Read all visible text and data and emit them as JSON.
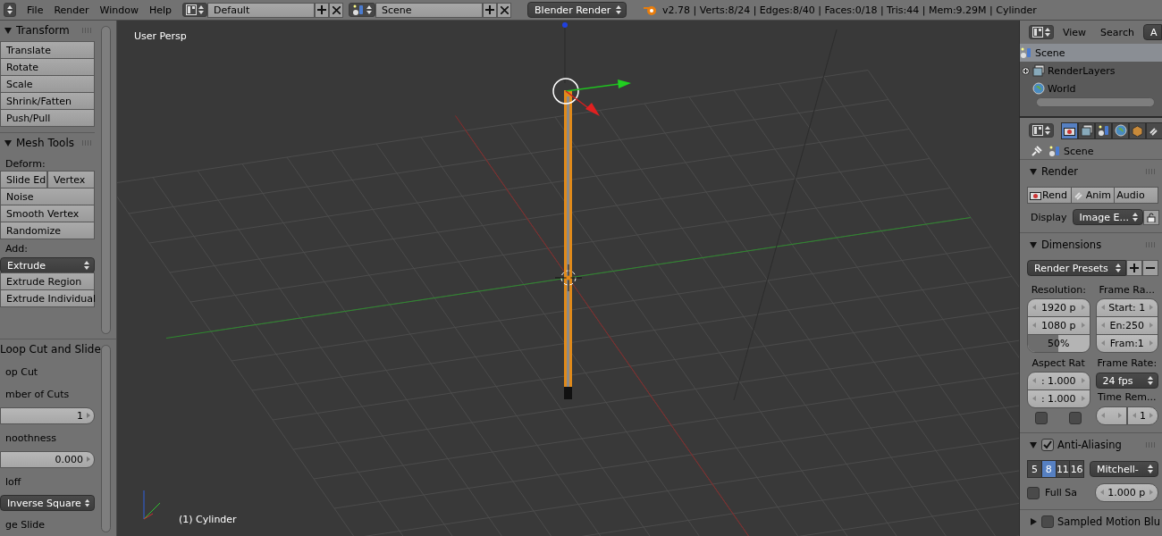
{
  "header": {
    "menus": [
      "File",
      "Render",
      "Window",
      "Help"
    ],
    "screen_layout": "Default",
    "scene": "Scene",
    "engine": "Blender Render",
    "stats": "v2.78 | Verts:8/24 | Edges:8/40 | Faces:0/18 | Tris:44 | Mem:9.29M | Cylinder"
  },
  "tool_shelf": {
    "panels": [
      {
        "title": "Transform",
        "expanded": true,
        "items": [
          {
            "kind": "button",
            "label": "Translate"
          },
          {
            "kind": "button",
            "label": "Rotate"
          },
          {
            "kind": "button",
            "label": "Scale"
          },
          {
            "kind": "button",
            "label": "Shrink/Fatten"
          },
          {
            "kind": "button",
            "label": "Push/Pull"
          }
        ]
      },
      {
        "title": "Mesh Tools",
        "expanded": true,
        "items": [
          {
            "kind": "label",
            "label": "Deform:"
          },
          {
            "kind": "pair",
            "labels": [
              "Slide Ed",
              "Vertex"
            ]
          },
          {
            "kind": "button",
            "label": "Noise"
          },
          {
            "kind": "button",
            "label": "Smooth Vertex"
          },
          {
            "kind": "button",
            "label": "Randomize"
          },
          {
            "kind": "label",
            "label": "Add:"
          },
          {
            "kind": "dropdown",
            "label": "Extrude"
          },
          {
            "kind": "button",
            "label": "Extrude Region"
          },
          {
            "kind": "button",
            "label": "Extrude Individual"
          }
        ]
      }
    ],
    "operator": {
      "title": "Loop Cut and Slide",
      "items": [
        {
          "kind": "label",
          "label": "op Cut"
        },
        {
          "kind": "label",
          "label": "mber of Cuts"
        },
        {
          "kind": "number",
          "label": "1"
        },
        {
          "kind": "label",
          "label": "noothness"
        },
        {
          "kind": "number",
          "label": "0.000"
        },
        {
          "kind": "label",
          "label": "loff"
        },
        {
          "kind": "dropdown",
          "label": "Inverse Square"
        },
        {
          "kind": "label",
          "label": "ge Slide"
        }
      ]
    }
  },
  "viewport": {
    "view_name": "User Persp",
    "object_label": "(1) Cylinder"
  },
  "outliner": {
    "menus": [
      "View",
      "Search"
    ],
    "display_mode": "A",
    "tree": [
      {
        "kind": "scene",
        "label": "Scene",
        "selected": true,
        "children": [
          {
            "kind": "render_layers",
            "label": "RenderLayers",
            "selected": false,
            "expanded": false
          },
          {
            "kind": "world",
            "label": "World",
            "selected": false
          }
        ]
      }
    ]
  },
  "properties": {
    "tabs": [
      {
        "kind": "render",
        "selected": true
      },
      {
        "kind": "render_layers",
        "selected": false
      },
      {
        "kind": "scene",
        "selected": false
      },
      {
        "kind": "world",
        "selected": false
      },
      {
        "kind": "object",
        "selected": false
      },
      {
        "kind": "constraints",
        "selected": false
      }
    ],
    "context": "Scene",
    "panels": [
      {
        "kind": "render",
        "title": "Render",
        "expanded": true,
        "buttons": [
          "Rend",
          "Anim",
          "Audio"
        ],
        "display_label": "Display",
        "display_value": "Image E..."
      },
      {
        "kind": "dimensions",
        "title": "Dimensions",
        "expanded": true,
        "presets": "Render Presets",
        "resolution_label": "Resolution:",
        "resolution_x": "1920 p",
        "resolution_y": "1080 p",
        "percentage": {
          "label": "50%",
          "level": 0.5
        },
        "frame_range_label": "Frame Ra...",
        "frame_start": "Start: 1",
        "frame_end": "En:250",
        "frame_step": "Fram:1",
        "aspect_label": "Aspect Rat",
        "aspect_x": ": 1.000",
        "aspect_y": ": 1.000",
        "border": {
          "checked": false
        },
        "crop": {
          "checked": false
        },
        "frame_rate_label": "Frame Rate:",
        "frame_rate": "24 fps",
        "time_remap_label": "Time Rem...",
        "time_remap_new": "1"
      },
      {
        "kind": "anti_aliasing",
        "title": "Anti-Aliasing",
        "expanded": true,
        "enabled": true,
        "samples": [
          {
            "label": "5",
            "selected": false
          },
          {
            "label": "8",
            "selected": true
          },
          {
            "label": "11",
            "selected": false
          },
          {
            "label": "16",
            "selected": false
          }
        ],
        "filter": "Mitchell-",
        "full_sample": {
          "label": "Full Sa",
          "checked": false
        },
        "size": "1.000 p"
      },
      {
        "kind": "motion_blur",
        "title": "Sampled Motion Blu",
        "expanded": false,
        "enabled": false
      }
    ]
  }
}
